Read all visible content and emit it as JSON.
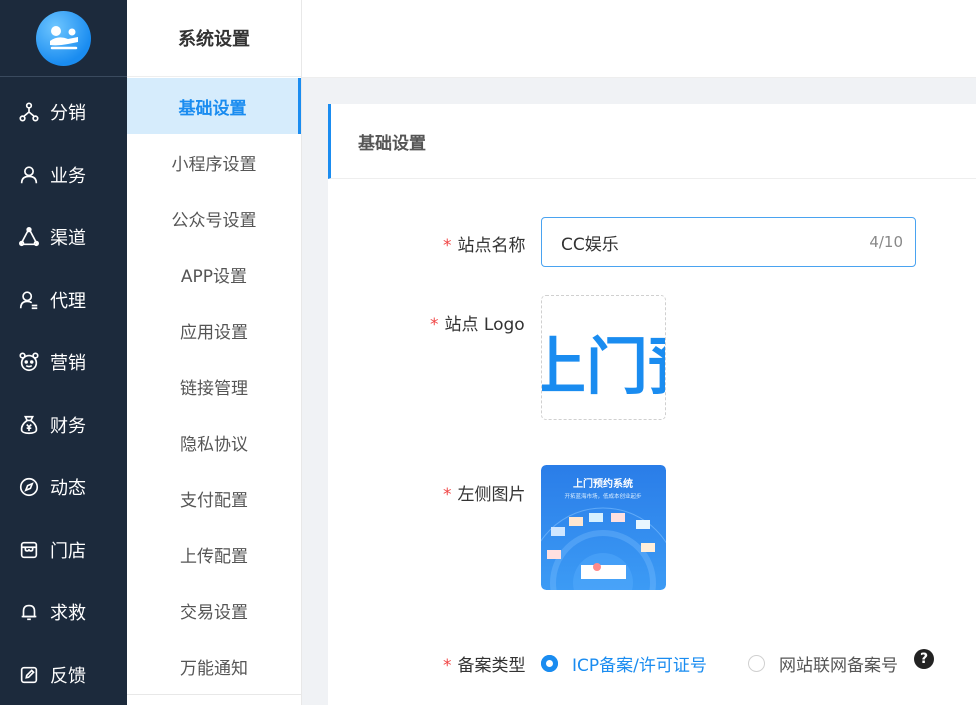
{
  "nav": {
    "items": [
      {
        "label": "分销",
        "icon": "network-icon"
      },
      {
        "label": "业务",
        "icon": "user-icon"
      },
      {
        "label": "渠道",
        "icon": "channel-icon"
      },
      {
        "label": "代理",
        "icon": "agent-icon"
      },
      {
        "label": "营销",
        "icon": "marketing-icon"
      },
      {
        "label": "财务",
        "icon": "money-bag-icon"
      },
      {
        "label": "动态",
        "icon": "compass-icon"
      },
      {
        "label": "门店",
        "icon": "store-icon"
      },
      {
        "label": "求救",
        "icon": "bell-icon"
      },
      {
        "label": "反馈",
        "icon": "feedback-icon"
      }
    ]
  },
  "submenu": {
    "title": "系统设置",
    "items": [
      {
        "label": "基础设置",
        "active": true
      },
      {
        "label": "小程序设置"
      },
      {
        "label": "公众号设置"
      },
      {
        "label": "APP设置"
      },
      {
        "label": "应用设置"
      },
      {
        "label": "链接管理"
      },
      {
        "label": "隐私协议"
      },
      {
        "label": "支付配置"
      },
      {
        "label": "上传配置"
      },
      {
        "label": "交易设置"
      },
      {
        "label": "万能通知"
      }
    ]
  },
  "card": {
    "title": "基础设置"
  },
  "form": {
    "required_mark": "*",
    "site_name_label": "站点名称",
    "site_name_value": "CC娱乐",
    "site_name_count": "4/10",
    "site_logo_label": "站点 Logo",
    "logo_image_text": "上门预约",
    "left_image_label": "左侧图片",
    "left_image_title": "上门预约系统",
    "left_image_subtitle": "开拓蓝海市场，低成本创业起步",
    "record_type_label": "备案类型",
    "record_options": [
      "ICP备案/许可证号",
      "网站联网备案号"
    ],
    "record_selected": 0,
    "help_mark": "?"
  },
  "colors": {
    "nav_bg": "#1c2a3c",
    "accent": "#1a8cf0",
    "active_bg": "#d6ecfc",
    "required": "#f04646"
  }
}
